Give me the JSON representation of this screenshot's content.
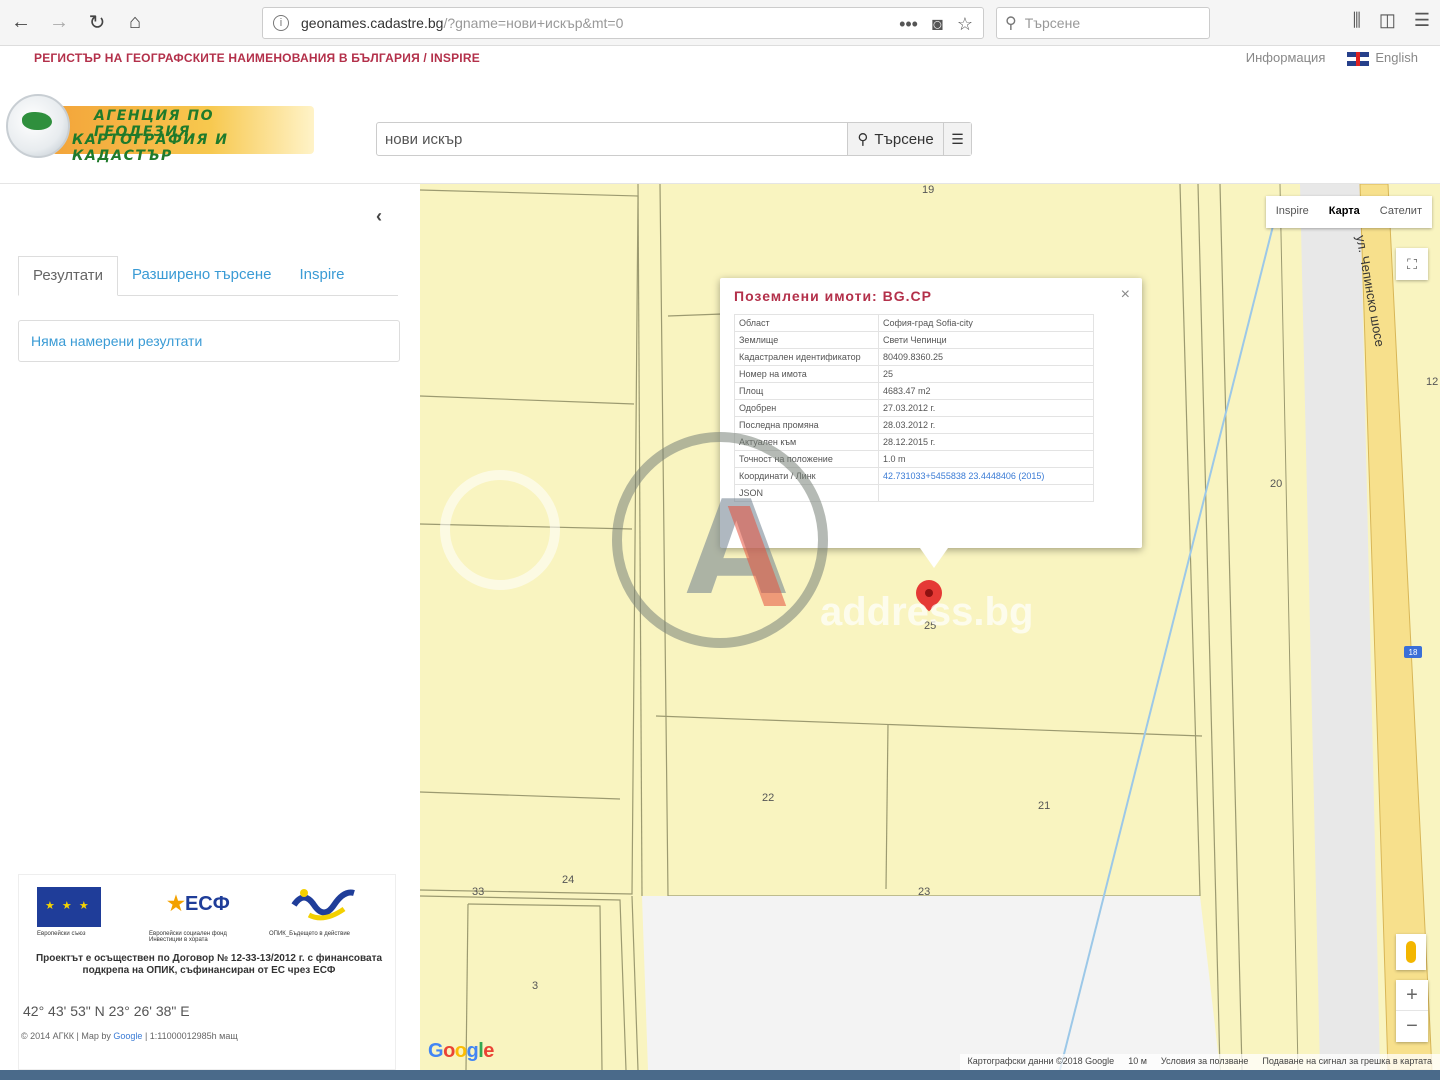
{
  "browser": {
    "url_domain": "geonames.cadastre.bg",
    "url_rest": "/?gname=нови+искър&mt=0",
    "url_prefix": "geonames.",
    "search_placeholder": "Търсене"
  },
  "site": {
    "register_title": "РЕГИСТЪР НА ГЕОГРАФСКИТЕ НАИМЕНОВАНИЯ В БЪЛГАРИЯ / INSPIRE",
    "info_link": "Информация",
    "lang_link": "English",
    "logo_line1": "АГЕНЦИЯ ПО ГЕОДЕЗИЯ,",
    "logo_line2": "КАРТОГРАФИЯ И КАДАСТЪР",
    "search_value": "нови искър",
    "search_button": "Търсене"
  },
  "left_panel": {
    "tabs": [
      "Резултати",
      "Разширено търсене",
      "Inspire"
    ],
    "no_results": "Няма намерени резултати",
    "eu_caption": "Европейски съюз",
    "esf_caption": "Европейски социален фонд Инвестиции в хората",
    "opik_caption": "ОПИК_Бъдещето в действие",
    "eu_text": "Проектът е осъществен по Договор № 12-33-13/2012 г. с финансовата подкрепа на ОПИК, съфинансиран от ЕС чрез ЕСФ",
    "coordinates": "42° 43' 53\" N 23° 26' 38\" E",
    "credits_prefix": "© 2014 АГКК | Map by",
    "credits_link": "Google",
    "credits_suffix": "| 1:11000012985h мащ"
  },
  "map": {
    "types": [
      "Inspire",
      "Карта",
      "Сателит"
    ],
    "active_type": "Карта",
    "street": "ул. Чепинско шосе",
    "parcels": [
      "19",
      "20",
      "21",
      "22",
      "23",
      "24",
      "25",
      "33",
      "3",
      "12"
    ],
    "road_badge": "18",
    "footer": [
      "Картографски данни ©2018 Google",
      "10 м",
      "Условия за ползване",
      "Подаване на сигнал за грешка в картата"
    ],
    "popup": {
      "title": "Поземлени имоти: BG.CP",
      "rows": [
        {
          "k": "Област",
          "v": "София-град Sofia-city"
        },
        {
          "k": "Землище",
          "v": "Свети Чепинци"
        },
        {
          "k": "Кадастрален идентификатор",
          "v": "80409.8360.25"
        },
        {
          "k": "Номер на имота",
          "v": "25"
        },
        {
          "k": "Площ",
          "v": "4683.47 m2"
        },
        {
          "k": "Одобрен",
          "v": "27.03.2012 г."
        },
        {
          "k": "Последна промяна",
          "v": "28.03.2012 г."
        },
        {
          "k": "Актуален към",
          "v": "28.12.2015 г."
        },
        {
          "k": "Точност на положение",
          "v": "1.0 m"
        },
        {
          "k": "Координати / Линк",
          "v": "42.731033+5455838 23.4448406 (2015)"
        },
        {
          "k": "JSON",
          "v": ""
        }
      ]
    }
  },
  "watermark": "address.bg"
}
